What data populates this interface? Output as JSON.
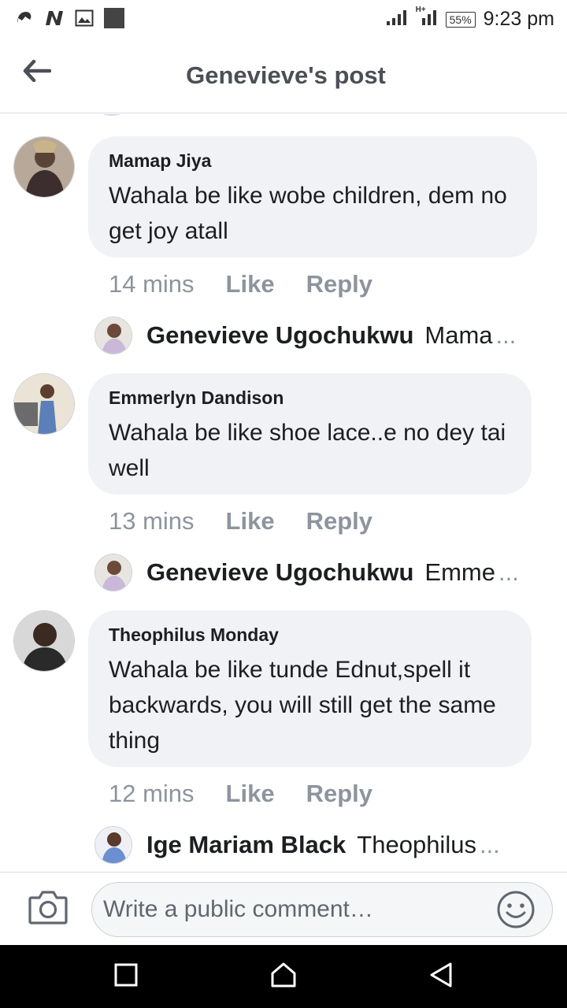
{
  "status_bar": {
    "time": "9:23 pm",
    "battery": "55%",
    "network": "H+",
    "icons": [
      "messenger-icon",
      "n-app-icon",
      "image-icon",
      "square-icon",
      "signal-icon",
      "battery-icon"
    ]
  },
  "header": {
    "title": "Genevieve's post",
    "back_icon": "back-arrow-icon"
  },
  "comments": [
    {
      "author": "Mamap Jiya",
      "text": "Wahala be like wobe children, dem no get joy atall",
      "time": "14 mins",
      "like": "Like",
      "reply": "Reply",
      "reply_preview": {
        "name": "Genevieve Ugochukwu",
        "text": "Mama",
        "ellipsis": "..."
      }
    },
    {
      "author": "Emmerlyn Dandison",
      "text": "Wahala be like shoe lace..e no dey tai well",
      "time": "13 mins",
      "like": "Like",
      "reply": "Reply",
      "reply_preview": {
        "name": "Genevieve Ugochukwu",
        "text": "Emme",
        "ellipsis": "..."
      }
    },
    {
      "author": "Theophilus Monday",
      "text": "Wahala be like tunde Ednut,spell it backwards, you will still get the same thing",
      "time": "12 mins",
      "like": "Like",
      "reply": "Reply",
      "reply_preview": {
        "name": "Ige Mariam Black",
        "text": "Theophilus",
        "ellipsis": "..."
      }
    }
  ],
  "composer": {
    "placeholder": "Write a public comment…",
    "camera_icon": "camera-icon",
    "emoji_icon": "smiley-icon"
  },
  "nav": {
    "buttons": [
      "recents-square-icon",
      "home-icon",
      "back-triangle-icon"
    ]
  }
}
